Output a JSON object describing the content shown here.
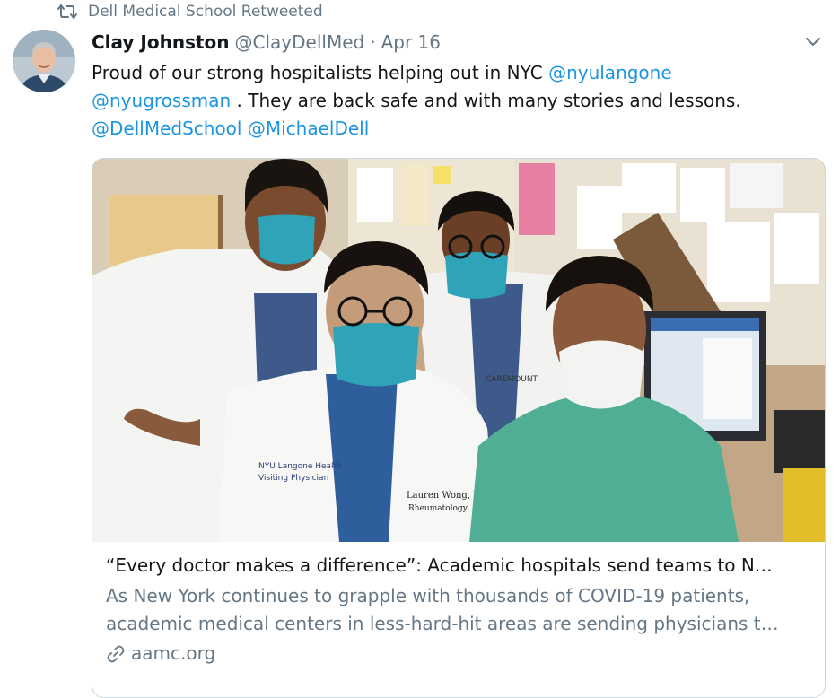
{
  "retweet": {
    "icon": "retweet-icon",
    "label": "Dell Medical School Retweeted"
  },
  "tweet": {
    "author": {
      "name": "Clay Johnston",
      "handle": "@ClayDellMed",
      "avatar_icon": "profile-photo"
    },
    "separator": "·",
    "timestamp": "Apr 16",
    "menu_icon": "chevron-down-icon",
    "text": {
      "part1": "Proud of our strong hospitalists helping out in NYC ",
      "mention1": "@nyulangone",
      "mention2": "@nyugrossman",
      "part2": " .  They are back safe and with many stories and lessons.",
      "mention3": "@DellMedSchool",
      "mention4": "@MichaelDell"
    }
  },
  "card": {
    "title": "“Every doctor makes a difference”: Academic hospitals send teams to N…",
    "description": "As New York continues to grapple with thousands of COVID-19 patients, academic medical centers in less-hard-hit areas are sending physicians t…",
    "domain_icon": "link-icon",
    "domain": "aamc.org",
    "photo_text": {
      "coat_logo": "NYU Langone Health",
      "coat_role": "Visiting Physician",
      "badge_name": "Lauren Wong, MD",
      "badge_dept": "Rheumatology",
      "sign": "CAREMOUNT"
    }
  },
  "colors": {
    "text": "#14171a",
    "secondary": "#657786",
    "link": "#1b95e0",
    "border": "#ccd6dd"
  }
}
